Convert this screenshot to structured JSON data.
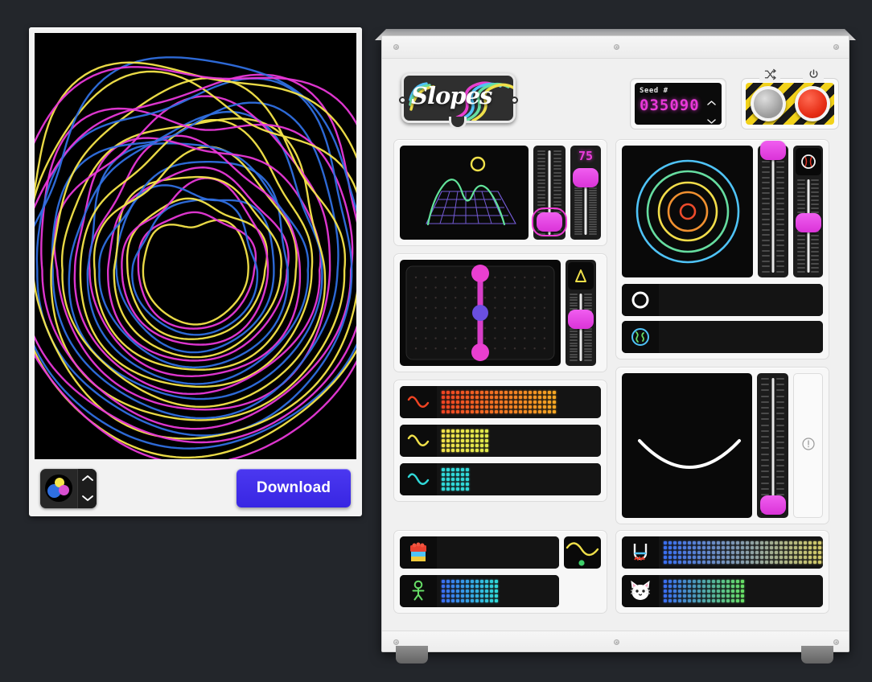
{
  "app": {
    "title": "Slopes",
    "logo_text": "Slopes"
  },
  "artwork": {
    "title": "generative-slopes-artwork",
    "background": "#000000",
    "palette": {
      "yellow": "#f5e54a",
      "magenta": "#e838d8",
      "blue": "#2f6fe0"
    },
    "palette_label": "color-palette-swatch",
    "stepper_up": "⌃",
    "stepper_down": "⌄",
    "download_label": "Download",
    "download_color": "#3826e3"
  },
  "seed": {
    "label": "Seed #",
    "value": "035090",
    "up_arrow": "⌃",
    "down_arrow": "⌄",
    "digit_color": "#e838d8"
  },
  "buttons": {
    "shuffle_icon": "shuffle-icon",
    "shuffle_label": "Shuffle",
    "power_icon": "power-icon",
    "power_label": "Power",
    "shuffle_color": "#b4b4b4",
    "power_color": "#e62d15",
    "hazard_colors": [
      "#f2d21a",
      "#1a1a1a"
    ]
  },
  "modules": {
    "terrain": {
      "name": "terrain-preview",
      "sun_color": "#f5e54a",
      "ridge_color": "#62e39a",
      "grid_color": "#7a5fe0",
      "slider_a_value": 28,
      "slider_b_value": 80,
      "slider_b_digits": "75"
    },
    "pad": {
      "name": "xy-control-pad",
      "handle_top_color": "#e93fd0",
      "handle_mid_color": "#6a4fe0",
      "handle_bottom_color": "#e93fd0",
      "line_color": "#d83fc8",
      "slider_icon": "triangle-icon",
      "slider_icon_color": "#f0e04a",
      "slider_value": 42
    },
    "meters": [
      {
        "name": "meter-red",
        "wave_icon": "wave-icon",
        "color": "#ef4423",
        "color2": "#f5a623",
        "cols": 24,
        "rows": 5,
        "fill": 24
      },
      {
        "name": "meter-yellow",
        "wave_icon": "wave-icon",
        "color": "#f0e04a",
        "color2": "#dfe84a",
        "cols": 24,
        "rows": 5,
        "fill": 10
      },
      {
        "name": "meter-cyan",
        "wave_icon": "wave-icon",
        "color": "#30d8d8",
        "color2": "#30d8d8",
        "cols": 24,
        "rows": 5,
        "fill": 6
      }
    ],
    "rings": {
      "name": "rings-preview",
      "colors": [
        "#4fc3f7",
        "#66dda0",
        "#f2dd4a",
        "#f09030",
        "#ee4b2b"
      ],
      "slider_a_value": 96,
      "slider_b_value": 52,
      "slider_b_icon": "ball-icon"
    },
    "toggle_rows": [
      {
        "name": "row-circle",
        "icon": "circle-outline-icon",
        "icon_color": "#ffffff",
        "cols": 0
      },
      {
        "name": "row-globe",
        "icon": "globe-icon",
        "icon_color": "#4fc3f7",
        "cols": 0
      }
    ],
    "curve": {
      "name": "curve-preview",
      "curve_color": "#ffffff",
      "slider_value": 8,
      "side_icon": "info-icon"
    },
    "bottom_rows": [
      {
        "name": "row-blocks",
        "icon": "lego-brick-icon",
        "cols": 0,
        "color": "#e8412f"
      },
      {
        "name": "row-figure",
        "icon": "stick-figure-icon",
        "cols": 24,
        "rows": 5,
        "fill": 12,
        "color": "#3a6ff0",
        "color2": "#30d8d8"
      },
      {
        "name": "row-beaker",
        "icon": "beaker-icon",
        "cols": 40,
        "rows": 5,
        "fill": 40,
        "color": "#3a6ff0",
        "color2": "#f2dd4a"
      },
      {
        "name": "row-cat",
        "icon": "cat-icon",
        "cols": 40,
        "rows": 5,
        "fill": 17,
        "color": "#3a6ff0",
        "color2": "#66dd66"
      }
    ],
    "wave_thumb": {
      "name": "wave-thumbnail",
      "color": "#f0e04a",
      "dot_color": "#3ecf6a"
    }
  }
}
